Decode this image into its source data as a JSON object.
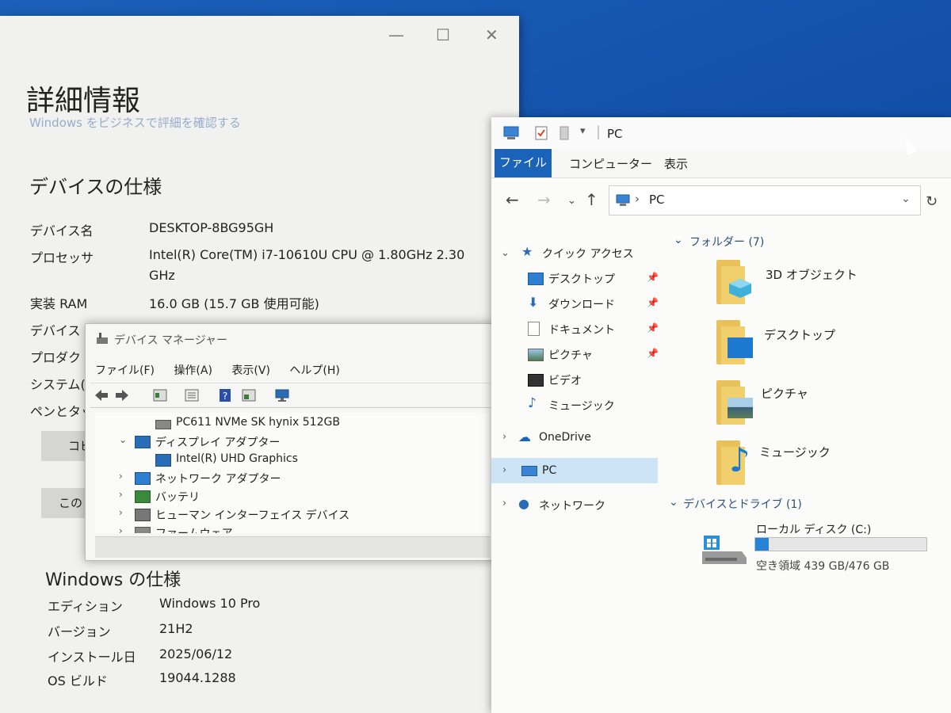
{
  "settings": {
    "title": "詳細情報",
    "faded_link": "Windows をビジネスで評細を確認する",
    "device_heading": "デバイスの仕様",
    "specs": [
      {
        "label": "デバイス名",
        "value": "DESKTOP-8BG95GH"
      },
      {
        "label": "プロセッサ",
        "value": "Intel(R) Core(TM) i7-10610U CPU @ 1.80GHz   2.30",
        "value2": "GHz"
      },
      {
        "label": "実装 RAM",
        "value": "16.0 GB (15.7 GB 使用可能)"
      },
      {
        "label": "デバイス",
        "value": ""
      },
      {
        "label": "プロダクト",
        "value": ""
      },
      {
        "label": "システム(",
        "value": ""
      },
      {
        "label": "ペンとタッ",
        "value": ""
      }
    ],
    "copy_button": "コピ",
    "rename_button": "この P",
    "windows_heading": "Windows の仕様",
    "win_specs": [
      {
        "label": "エディション",
        "value": "Windows 10 Pro"
      },
      {
        "label": "バージョン",
        "value": "21H2"
      },
      {
        "label": "インストール日",
        "value": "2025/06/12"
      },
      {
        "label": "OS ビルド",
        "value": "19044.1288"
      }
    ]
  },
  "device_manager": {
    "title": "デバイス マネージャー",
    "menu": [
      "ファイル(F)",
      "操作(A)",
      "表示(V)",
      "ヘルプ(H)"
    ],
    "tree": [
      {
        "label": "PC611 NVMe SK hynix 512GB",
        "indent": 2,
        "chevron": ""
      },
      {
        "label": "ディスプレイ アダプター",
        "indent": 1,
        "chevron": "v"
      },
      {
        "label": "Intel(R) UHD Graphics",
        "indent": 2,
        "chevron": ""
      },
      {
        "label": "ネットワーク アダプター",
        "indent": 1,
        "chevron": ">"
      },
      {
        "label": "バッテリ",
        "indent": 1,
        "chevron": ">"
      },
      {
        "label": "ヒューマン インターフェイス デバイス",
        "indent": 1,
        "chevron": ">"
      },
      {
        "label": "ファームウェア",
        "indent": 1,
        "chevron": ">"
      }
    ]
  },
  "explorer": {
    "title": "PC",
    "tabs": {
      "file": "ファイル",
      "computer": "コンピューター",
      "view": "表示"
    },
    "address": "PC",
    "nav": {
      "quick_access": "クイック アクセス",
      "quick_items": [
        "デスクトップ",
        "ダウンロード",
        "ドキュメント",
        "ピクチャ",
        "ビデオ",
        "ミュージック"
      ],
      "onedrive": "OneDrive",
      "pc": "PC",
      "network": "ネットワーク"
    },
    "folders_heading": "フォルダー (7)",
    "folders": [
      "3D オブジェクト",
      "デスクトップ",
      "ピクチャ",
      "ミュージック"
    ],
    "drives_heading": "デバイスとドライブ (1)",
    "drive": {
      "name": "ローカル ディスク (C:)",
      "free": "空き領域 439 GB/476 GB",
      "used_fraction": 0.078
    },
    "colors": {
      "accent": "#1a63b8",
      "drive_fill": "#2683d9",
      "selected": "#cde4f7"
    }
  }
}
